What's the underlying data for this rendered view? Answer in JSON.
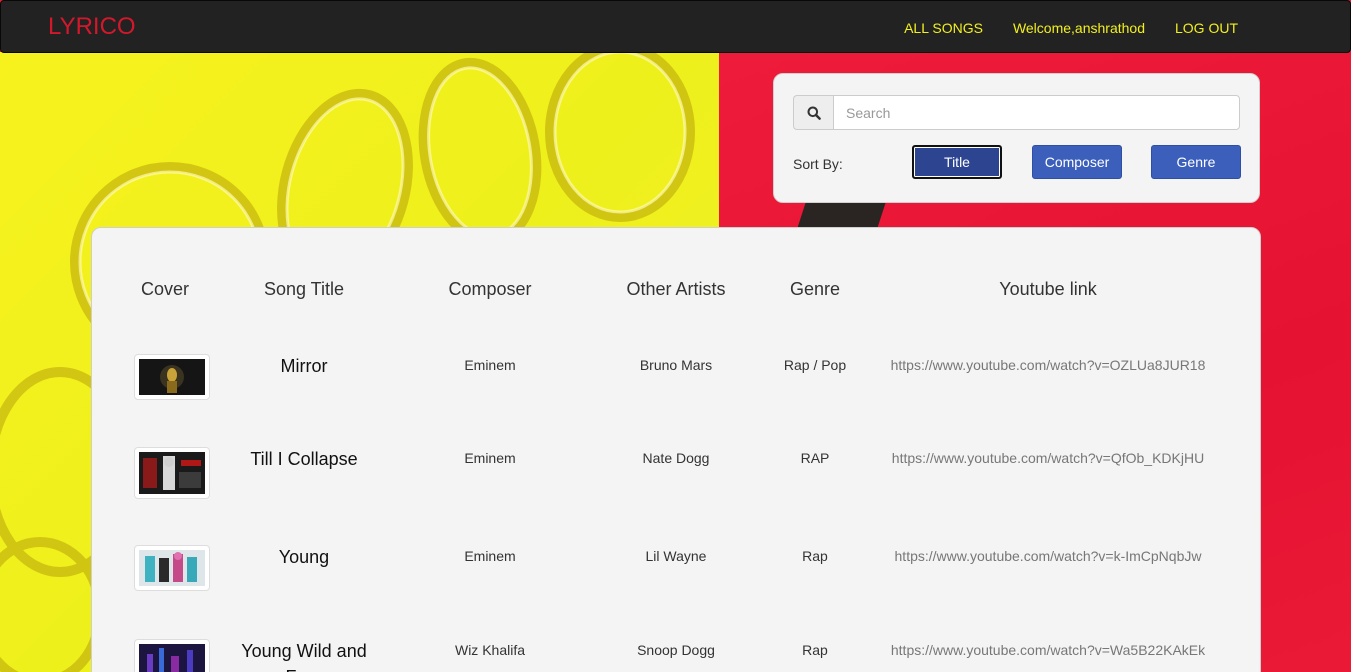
{
  "nav": {
    "brand": "LYRICO",
    "links": [
      {
        "label": "ALL SONGS"
      },
      {
        "label": "Welcome,anshrathod"
      },
      {
        "label": "LOG OUT"
      }
    ]
  },
  "search": {
    "placeholder": "Search",
    "value": "",
    "icon": "search-icon",
    "sort_label": "Sort By:",
    "sort_options": [
      {
        "label": "Title",
        "active": true
      },
      {
        "label": "Composer",
        "active": false
      },
      {
        "label": "Genre",
        "active": false
      }
    ]
  },
  "table": {
    "headers": [
      "Cover",
      "Song Title",
      "Composer",
      "Other Artists",
      "Genre",
      "Youtube link"
    ],
    "rows": [
      {
        "title": "Mirror",
        "composer": "Eminem",
        "other_artists": "Bruno Mars",
        "genre": "Rap / Pop",
        "youtube": "https://www.youtube.com/watch?v=OZLUa8JUR18"
      },
      {
        "title": "Till I Collapse",
        "composer": "Eminem",
        "other_artists": "Nate Dogg",
        "genre": "RAP",
        "youtube": "https://www.youtube.com/watch?v=QfOb_KDKjHU"
      },
      {
        "title": "Young",
        "composer": "Eminem",
        "other_artists": "Lil Wayne",
        "genre": "Rap",
        "youtube": "https://www.youtube.com/watch?v=k-ImCpNqbJw"
      },
      {
        "title": "Young Wild and Free",
        "composer": "Wiz Khalifa",
        "other_artists": "Snoop Dogg",
        "genre": "Rap",
        "youtube": "https://www.youtube.com/watch?v=Wa5B22KAkEk"
      }
    ]
  },
  "colors": {
    "navbar_bg": "#222222",
    "brand": "#d3182c",
    "nav_link": "#f2f01e",
    "button": "#3b5fbb",
    "bg_yellow": "#f2ef1e",
    "bg_red": "#ed1c34"
  }
}
